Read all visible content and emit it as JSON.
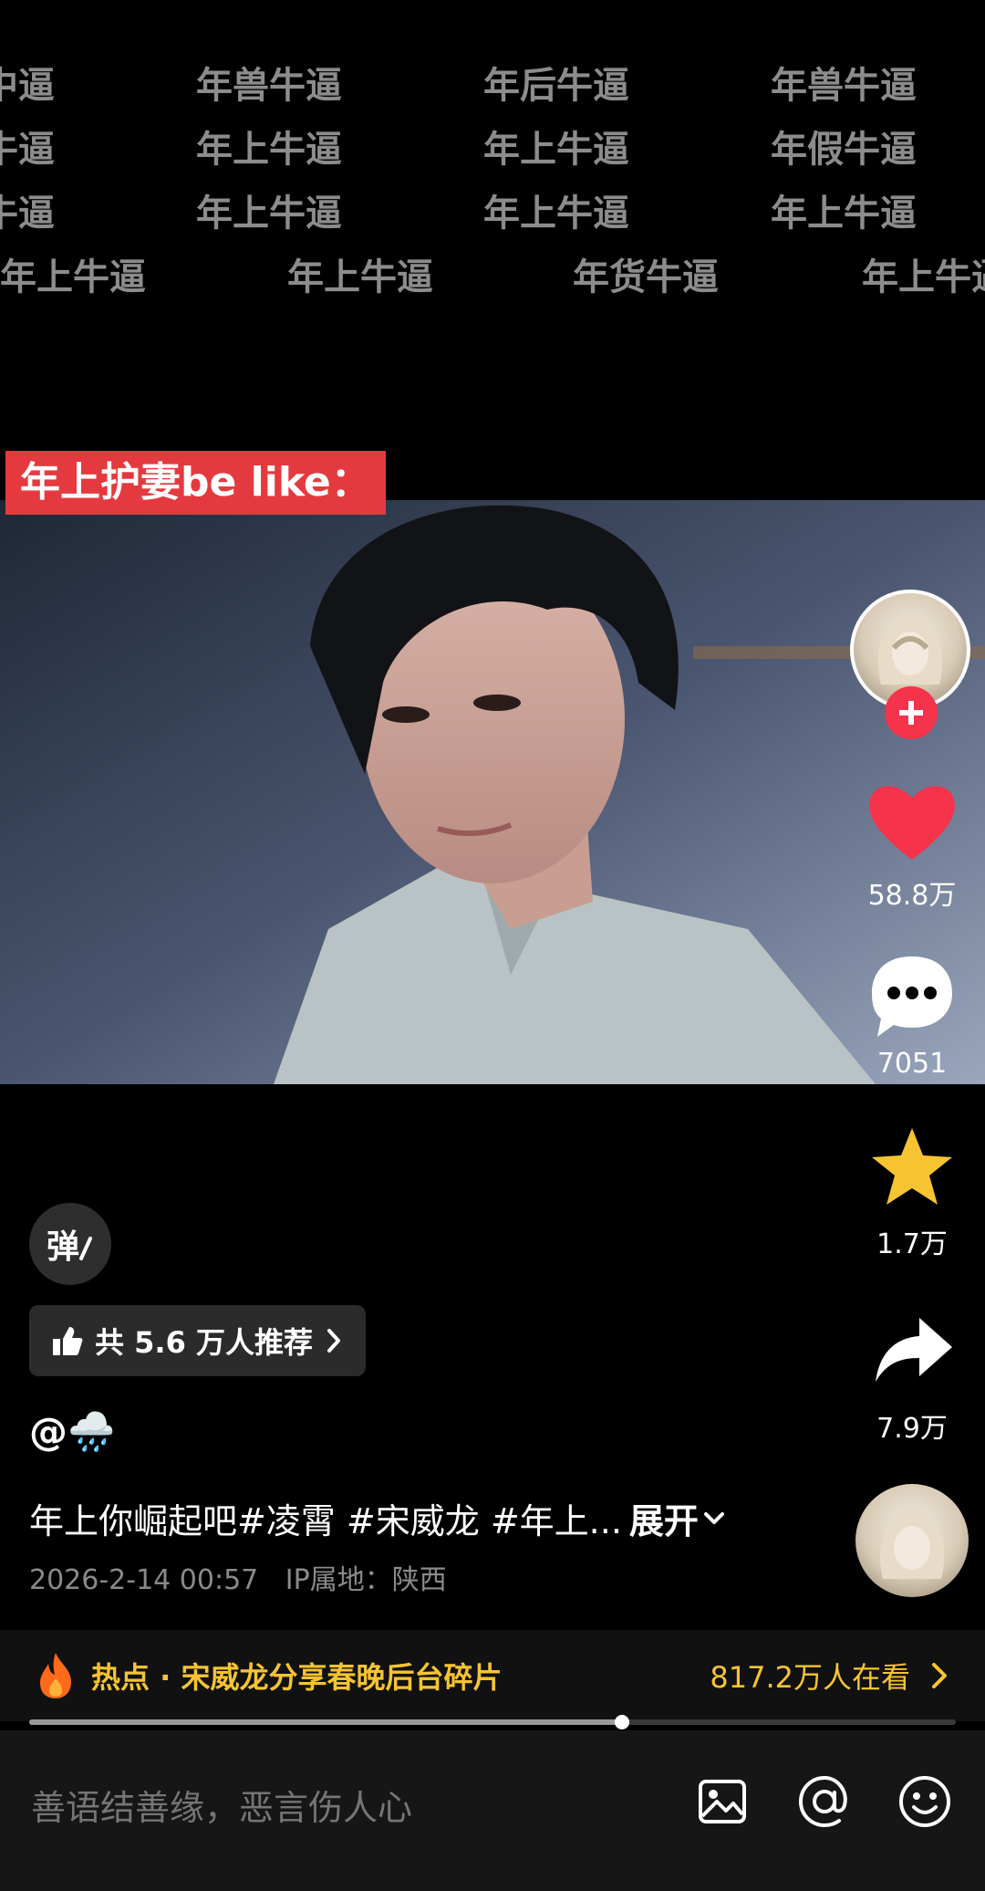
{
  "overlay": {
    "rows": [
      [
        "中逼",
        "年兽牛逼",
        "年后牛逼",
        "年兽牛逼"
      ],
      [
        "牛逼",
        "年上牛逼",
        "年上牛逼",
        "年假牛逼"
      ],
      [
        "牛逼",
        "年上牛逼",
        "年上牛逼",
        "年上牛逼"
      ],
      [
        "年上牛逼",
        "年上牛逼",
        "年货牛逼",
        "年上牛逼"
      ]
    ]
  },
  "caption": "年上护妻be like：",
  "rail": {
    "likes": "58.8万",
    "comments": "7051",
    "favorites": "1.7万",
    "shares": "7.9万",
    "like_color": "#f5334a",
    "star_color": "#f6c431"
  },
  "danmaku_toggle": "弹",
  "recommend": {
    "label": "共 5.6 万人推荐"
  },
  "author": {
    "handle": "@🌧️"
  },
  "description": {
    "text": "年上你崛起吧#凌霄 #宋威龙 #年上...",
    "expand": "展开"
  },
  "meta": {
    "date": "2026-2-14 00:57",
    "ip": "IP属地：陕西"
  },
  "hot": {
    "label": "热点 · 宋威龙分享春晚后台碎片",
    "viewers": "817.2万人在看",
    "accent": "#f6c431"
  },
  "progress": {
    "played_fraction": 0.64
  },
  "comment_input": {
    "placeholder": "善语结善缘，恶言伤人心"
  }
}
